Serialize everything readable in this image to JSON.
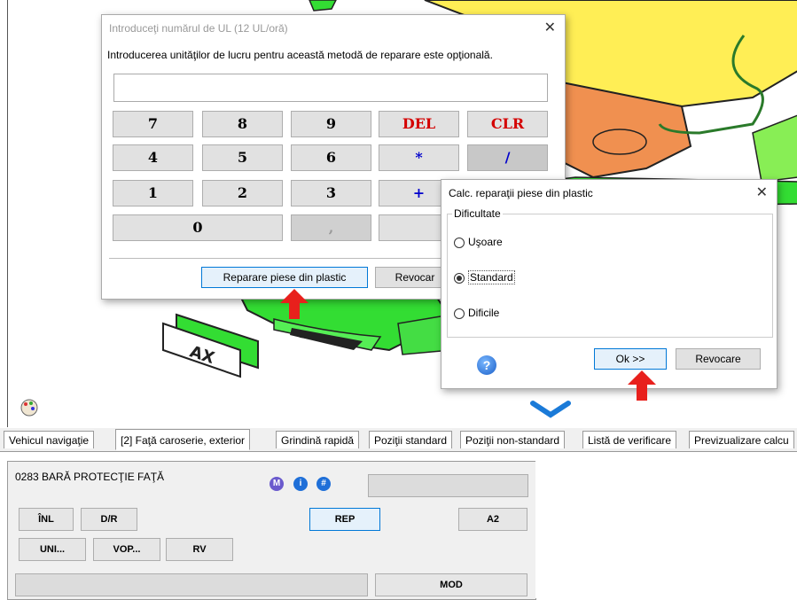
{
  "numpad_dialog": {
    "title": "Introduceţi numărul de UL (12 UL/oră)",
    "description": "Introducerea unităţilor de lucru pentru această metodă de reparare este opţională.",
    "input_value": "",
    "keys": {
      "k7": "7",
      "k8": "8",
      "k9": "9",
      "del": "DEL",
      "clr": "CLR",
      "k4": "4",
      "k5": "5",
      "k6": "6",
      "mul": "*",
      "div": "/",
      "k1": "1",
      "k2": "2",
      "k3": "3",
      "plus": "+",
      "k0": "0",
      "comma": ","
    },
    "btn_plastic": "Reparare piese din plastic",
    "btn_cancel": "Revocar"
  },
  "plastic_dialog": {
    "title": "Calc. reparaţii piese din plastic",
    "group_label": "Dificultate",
    "options": [
      "Uşoare",
      "Standard",
      "Dificile"
    ],
    "selected": "Standard",
    "btn_ok": "Ok >>",
    "btn_cancel": "Revocare",
    "help_icon": "help-icon"
  },
  "tabs": [
    "Vehicul navigaţie",
    "[2] Faţă caroserie, exterior",
    "Grindină rapidă",
    "Poziţii standard",
    "Poziţii non-standard",
    "Listă de verificare",
    "Previzualizare calcu"
  ],
  "active_tab": "[2] Faţă caroserie, exterior",
  "part_panel": {
    "part_name": "0283 BARĂ PROTECŢIE FAŢĂ",
    "icon_m": "M",
    "icon_i": "i",
    "icon_hash": "#",
    "buttons": {
      "inl": "ÎNL",
      "dr": "D/R",
      "rep": "REP",
      "a2": "A2",
      "uni": "UNI...",
      "vop": "VOP...",
      "rv": "RV",
      "mod": "MOD"
    }
  },
  "illustration": {
    "plate_text": "AX"
  },
  "colors": {
    "accent_blue": "#0078d7",
    "key_red": "#d40000",
    "key_blue": "#0000cc",
    "arrow_red": "#e8201c",
    "part_green": "#33dd33",
    "part_yellow": "#ffee55",
    "part_orange": "#f09050"
  }
}
